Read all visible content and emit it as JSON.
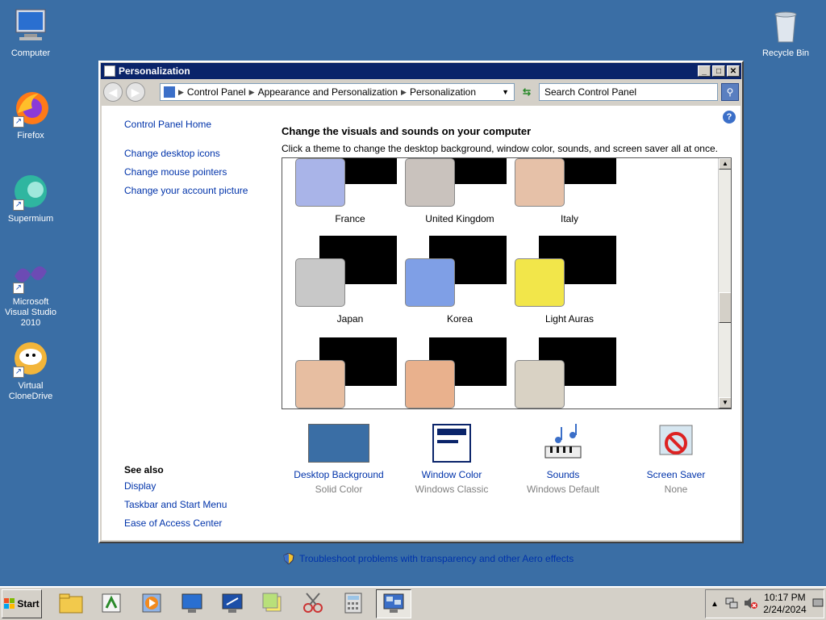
{
  "desktop": {
    "icons": [
      {
        "label": "Computer"
      },
      {
        "label": "Firefox"
      },
      {
        "label": "Supermium"
      },
      {
        "label": "Microsoft Visual Studio 2010"
      },
      {
        "label": "Virtual CloneDrive"
      },
      {
        "label": "Recycle Bin"
      }
    ]
  },
  "window": {
    "title": "Personalization",
    "breadcrumb": [
      "Control Panel",
      "Appearance and Personalization",
      "Personalization"
    ],
    "search_placeholder": "Search Control Panel",
    "left_links": [
      "Control Panel Home",
      "Change desktop icons",
      "Change mouse pointers",
      "Change your account picture"
    ],
    "see_also": {
      "heading": "See also",
      "links": [
        "Display",
        "Taskbar and Start Menu",
        "Ease of Access Center"
      ]
    },
    "main_title": "Change the visuals and sounds on your computer",
    "main_subtitle": "Click a theme to change the desktop background, window color, sounds, and screen saver all at once.",
    "themes": [
      {
        "name": "France",
        "color": "#a9b4e8"
      },
      {
        "name": "United Kingdom",
        "color": "#c9c2bd"
      },
      {
        "name": "Italy",
        "color": "#e6c1a8"
      },
      {
        "name": "Japan",
        "color": "#c8c8c8"
      },
      {
        "name": "Korea",
        "color": "#7f9fe6"
      },
      {
        "name": "Light Auras",
        "color": "#f2e64a"
      },
      {
        "name": "",
        "color": "#e7bea1"
      },
      {
        "name": "",
        "color": "#e9b18d"
      },
      {
        "name": "",
        "color": "#d9d2c4"
      }
    ],
    "bottom": [
      {
        "label": "Desktop Background",
        "sub": "Solid Color"
      },
      {
        "label": "Window Color",
        "sub": "Windows Classic"
      },
      {
        "label": "Sounds",
        "sub": "Windows Default"
      },
      {
        "label": "Screen Saver",
        "sub": "None"
      }
    ],
    "troubleshoot": "Troubleshoot problems with transparency and other Aero effects"
  },
  "taskbar": {
    "start_label": "Start",
    "time": "10:17 PM",
    "date": "2/24/2024"
  },
  "colors": {
    "desktop": "#3a6ea5",
    "titlebar": "#0a246a",
    "link": "#0033aa"
  }
}
